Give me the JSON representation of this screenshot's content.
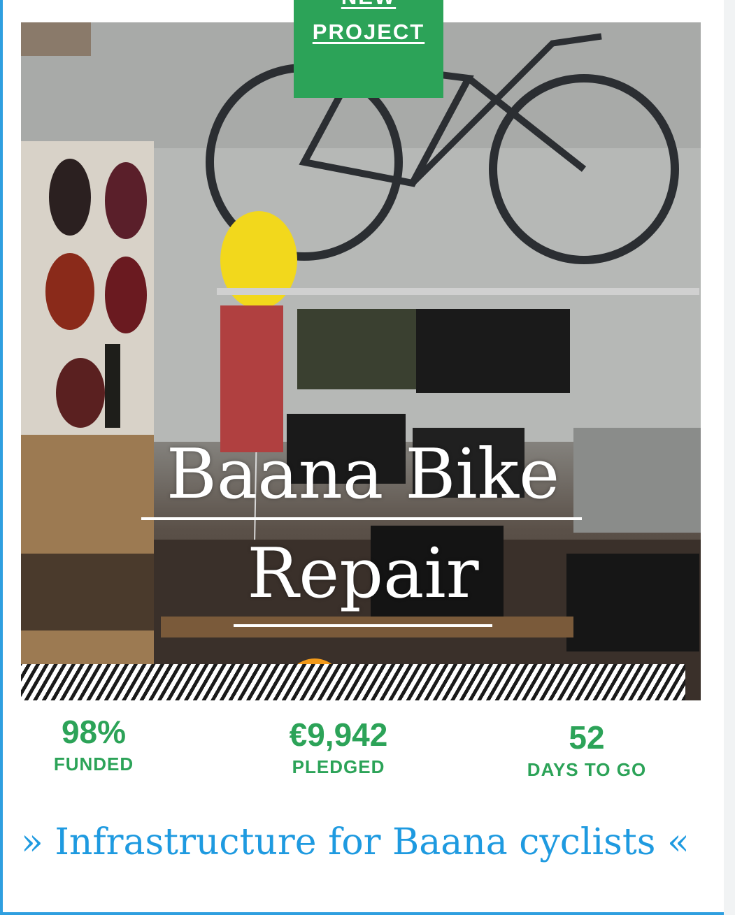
{
  "badge": {
    "line1": "NEW",
    "line2": "PROJECT"
  },
  "project": {
    "title_line1": "Baana Bike",
    "title_line2": "Repair",
    "tagline": "» Infrastructure for Baana cyclists «"
  },
  "stats": [
    {
      "value": "98%",
      "label": "FUNDED"
    },
    {
      "value": "€9,942",
      "label": "PLEDGED"
    },
    {
      "value": "52",
      "label": "DAYS TO GO"
    }
  ],
  "colors": {
    "accent_green": "#2ca358",
    "accent_blue": "#1e9ae0",
    "border_blue": "#2f9fe0"
  }
}
